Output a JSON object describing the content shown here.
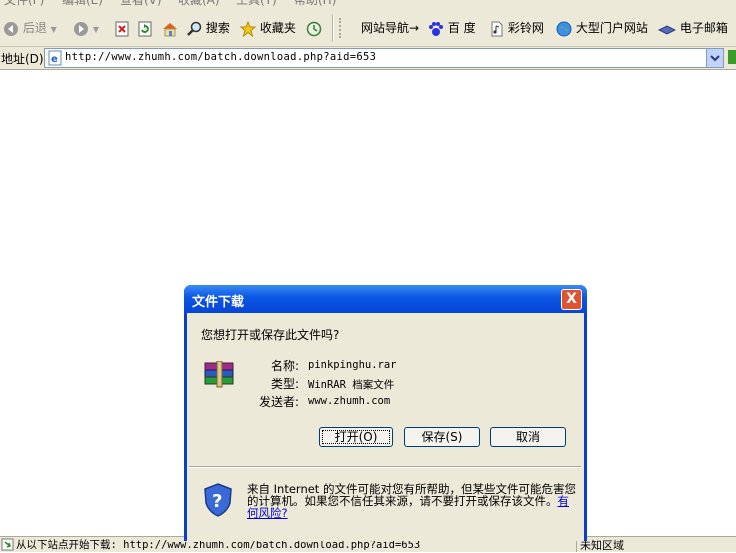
{
  "menu": [
    "文件(F)",
    "编辑(E)",
    "查看(V)",
    "收藏(A)",
    "工具(T)",
    "帮助(H)"
  ],
  "toolbar": {
    "back": "后退",
    "search": "搜索",
    "favorites": "收藏夹",
    "nav": "网站导航→",
    "baidu": "百 度",
    "caiyin": "彩铃网",
    "portal": "大型门户网站",
    "email": "电子邮箱"
  },
  "address": {
    "label": "地址(D)",
    "url": "http://www.zhumh.com/batch.download.php?aid=653"
  },
  "status": {
    "text": "从以下站点开始下载: http://www.zhumh.com/batch.download.php?aid=653",
    "zone": "未知区域"
  },
  "dialog": {
    "title": "文件下载",
    "close": "X",
    "question": "您想打开或保存此文件吗?",
    "name_label": "名称:",
    "name_value": "pinkpinghu.rar",
    "type_label": "类型:",
    "type_value": "WinRAR 档案文件",
    "from_label": "发送者:",
    "from_value": "www.zhumh.com",
    "open_btn": "打开(O)",
    "save_btn": "保存(S)",
    "cancel_btn": "取消",
    "warning": "来自 Internet 的文件可能对您有所帮助，但某些文件可能危害您的计算机。如果您不信任其来源，请不要打开或保存该文件。",
    "risk_link": "有何风险?"
  }
}
